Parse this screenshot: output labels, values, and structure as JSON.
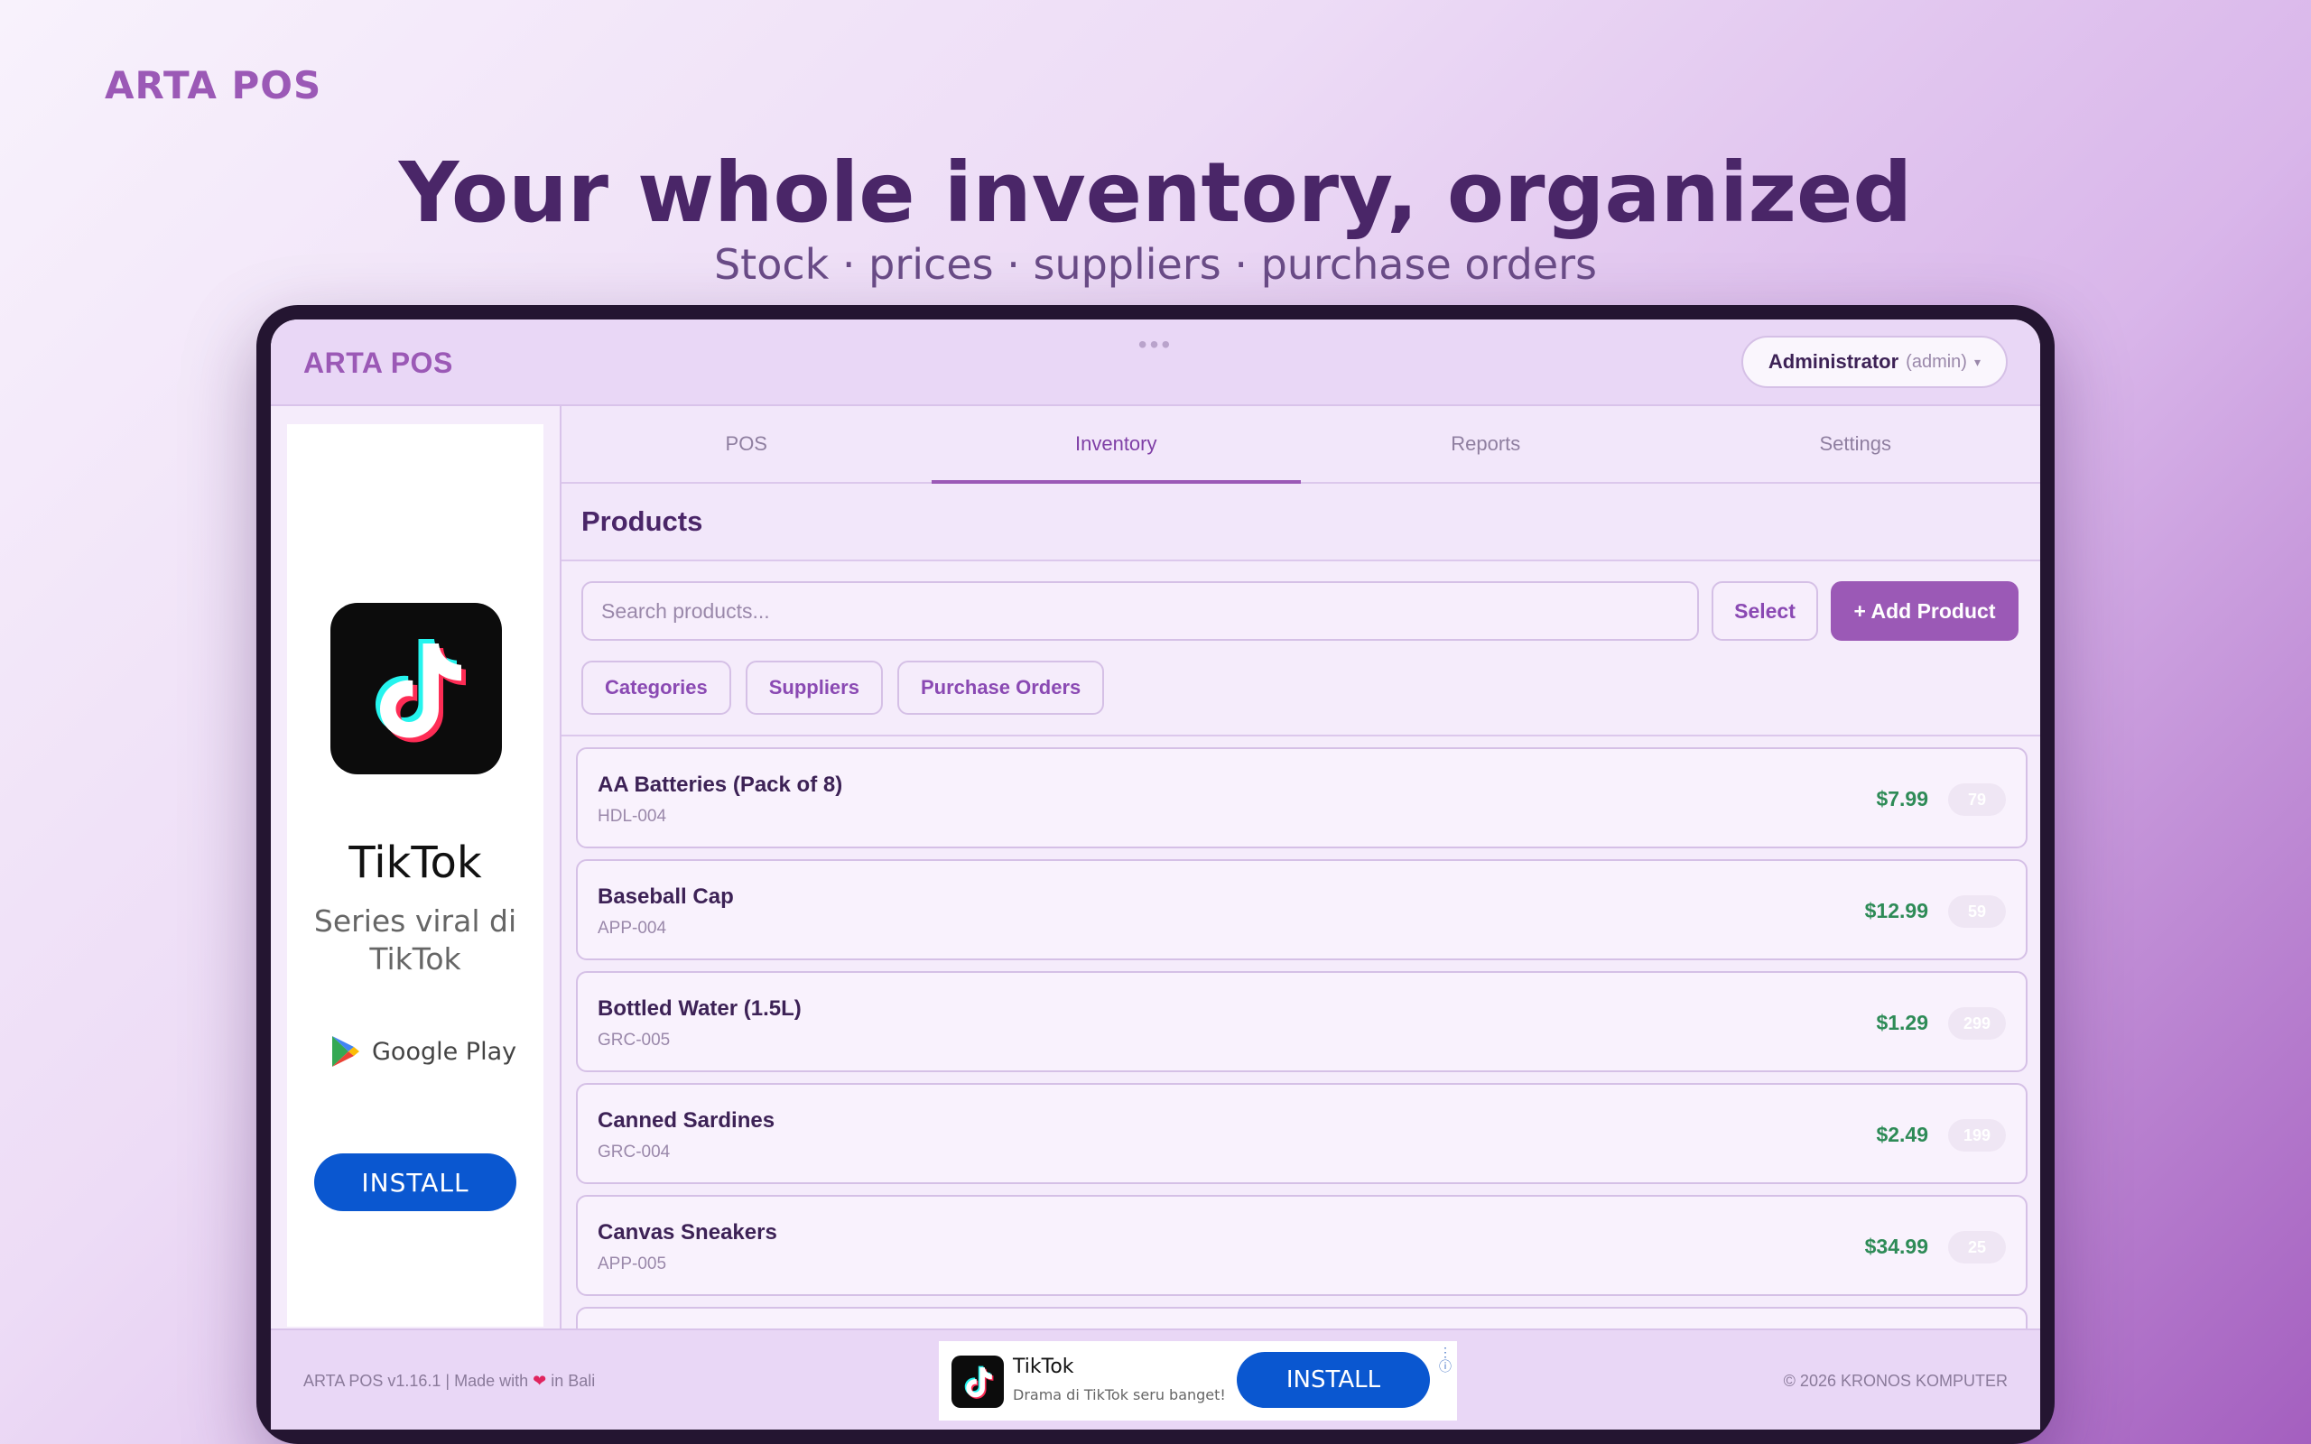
{
  "page": {
    "brand": "ARTA POS",
    "headline": "Your whole inventory, organized",
    "subheadline": "Stock · prices · suppliers · purchase orders"
  },
  "app": {
    "brand": "ARTA POS",
    "header_dots": "•••",
    "user": {
      "name": "Administrator",
      "role": "(admin)",
      "caret": "▾"
    },
    "tabs": [
      {
        "label": "POS",
        "active": false
      },
      {
        "label": "Inventory",
        "active": true
      },
      {
        "label": "Reports",
        "active": false
      },
      {
        "label": "Settings",
        "active": false
      }
    ],
    "panel_title": "Products",
    "search": {
      "placeholder": "Search products..."
    },
    "select_label": "Select",
    "add_label": "+ Add Product",
    "chips": [
      "Categories",
      "Suppliers",
      "Purchase Orders"
    ],
    "products": [
      {
        "name": "AA Batteries (Pack of 8)",
        "sku": "HDL-004",
        "price": "$7.99",
        "stock": "79"
      },
      {
        "name": "Baseball Cap",
        "sku": "APP-004",
        "price": "$12.99",
        "stock": "59"
      },
      {
        "name": "Bottled Water (1.5L)",
        "sku": "GRC-005",
        "price": "$1.29",
        "stock": "299"
      },
      {
        "name": "Canned Sardines",
        "sku": "GRC-004",
        "price": "$2.49",
        "stock": "199"
      },
      {
        "name": "Canvas Sneakers",
        "sku": "APP-005",
        "price": "$34.99",
        "stock": "25"
      }
    ],
    "footer": {
      "version": "ARTA POS v1.16.1 | Made with",
      "heart": "❤",
      "origin": "in Bali",
      "copyright": "© 2026 KRONOS KOMPUTER"
    }
  },
  "ads": {
    "sidebar": {
      "title": "TikTok",
      "description": "Series viral di TikTok",
      "store": "Google Play",
      "install_label": "INSTALL"
    },
    "banner": {
      "title": "TikTok",
      "description": "Drama di TikTok seru banget!",
      "install_label": "INSTALL",
      "menu_glyph": "⋮",
      "info_glyph": "ⓘ"
    }
  },
  "colors": {
    "accent": "#9b59b6",
    "heading": "#4a2668",
    "price": "#2e8b57",
    "ad_install": "#0a57d0"
  }
}
